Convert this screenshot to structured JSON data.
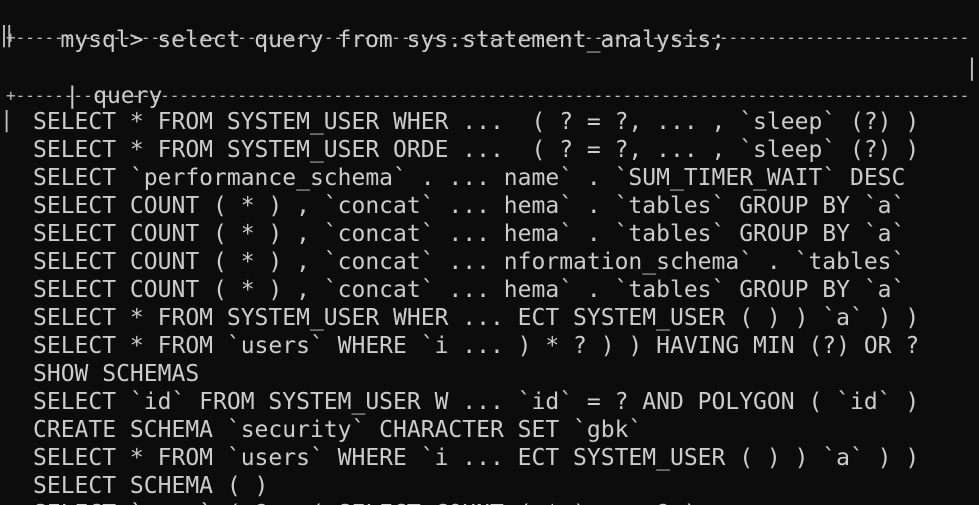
{
  "terminal": {
    "prompt": "mysql>",
    "command": " select query from sys.statement_analysis;",
    "table": {
      "border_top": "+---------------------------------------------------------------------------------------------------------+",
      "header_left": "|",
      "column_header": "query",
      "border_mid": "+---------------------------------------------------------------------------------------------------------+",
      "rows": [
        "SELECT * FROM SYSTEM_USER WHER ...  ( ? = ?, ... , `sleep` (?) )",
        "SELECT * FROM SYSTEM_USER ORDE ...  ( ? = ?, ... , `sleep` (?) )",
        "SELECT `performance_schema` . ... name` . `SUM_TIMER_WAIT` DESC",
        "SELECT COUNT ( * ) , `concat` ... hema` . `tables` GROUP BY `a`",
        "SELECT COUNT ( * ) , `concat` ... hema` . `tables` GROUP BY `a`",
        "SELECT COUNT ( * ) , `concat` ... nformation_schema` . `tables`",
        "SELECT COUNT ( * ) , `concat` ... hema` . `tables` GROUP BY `a`",
        "SELECT * FROM SYSTEM_USER WHER ... ECT SYSTEM_USER ( ) ) `a` ) )",
        "SELECT * FROM `users` WHERE `i ... ) * ? ) ) HAVING MIN (?) OR ?",
        "SHOW SCHEMAS",
        "SELECT `id` FROM SYSTEM_USER W ... `id` = ? AND POLYGON ( `id` )",
        "CREATE SCHEMA `security` CHARACTER SET `gbk`",
        "SELECT * FROM `users` WHERE `i ... ECT SYSTEM_USER ( ) ) `a` ) )",
        "SELECT SCHEMA ( )",
        "SELECT ` ...` ( ? , ( SELECT COUNT ( * ) ... ? )"
      ]
    }
  }
}
